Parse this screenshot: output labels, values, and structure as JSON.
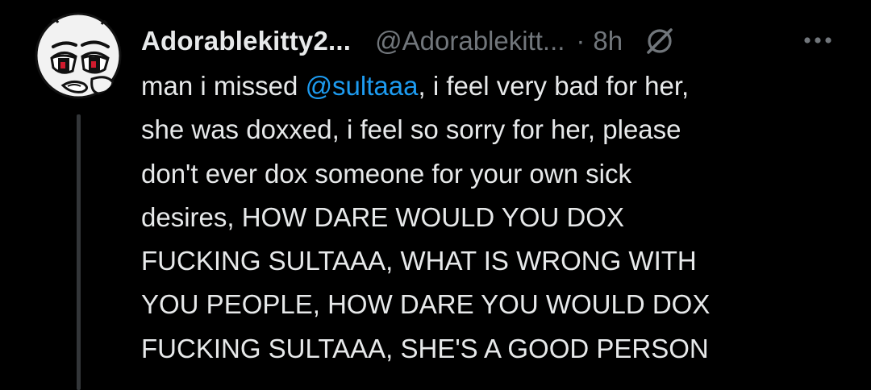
{
  "tweet": {
    "author": {
      "display_name": "Adorablekitty2...",
      "handle": "@Adorablekitt...",
      "avatar_icon": "cartoon-face-avatar"
    },
    "separator": "·",
    "time": "8h",
    "grok_icon": "grok-icon",
    "more_icon": "more-options-icon",
    "body": {
      "line1_prefix": "man i missed ",
      "mention": "@sultaaa",
      "line1_suffix": ", i feel very bad for her,",
      "line2": "she was doxxed, i feel so sorry for her, please",
      "line3": "don't ever dox someone for your own sick",
      "line4": "desires, HOW DARE WOULD YOU DOX",
      "line5": "FUCKING SULTAAA, WHAT IS WRONG WITH",
      "line6": "YOU PEOPLE, HOW DARE YOU WOULD DOX",
      "line7": "FUCKING SULTAAA, SHE'S A GOOD PERSON"
    },
    "colors": {
      "background": "#000000",
      "text": "#e7e9ea",
      "muted": "#71767b",
      "link": "#1d9bf0",
      "thread_line": "#333639"
    }
  }
}
